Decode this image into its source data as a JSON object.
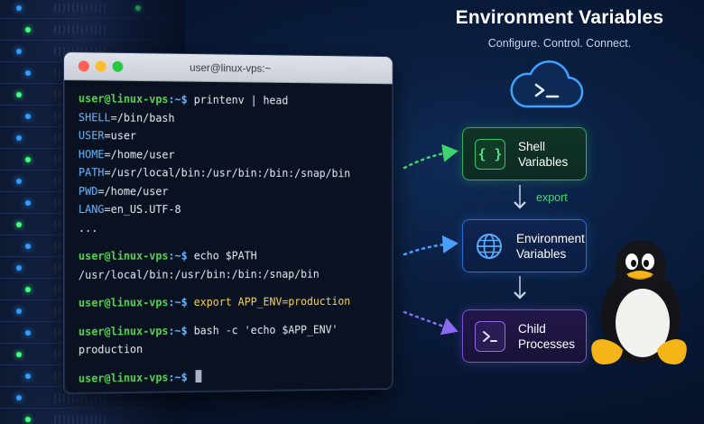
{
  "terminal": {
    "window_title": "user@linux-vps:~",
    "prompt_user": "user@linux-vps",
    "prompt_path": ":~$",
    "lines": [
      {
        "type": "prompt",
        "cmd": " printenv | head"
      },
      {
        "type": "var",
        "name": "SHELL",
        "value": "=/bin/bash"
      },
      {
        "type": "var",
        "name": "USER",
        "value": "=user"
      },
      {
        "type": "var",
        "name": "HOME",
        "value": "=/home/user"
      },
      {
        "type": "var",
        "name": "PATH",
        "value": "=/usr/local/bin:/usr/bin:/bin:/snap/bin"
      },
      {
        "type": "var",
        "name": "PWD",
        "value": "=/home/user"
      },
      {
        "type": "var",
        "name": "LANG",
        "value": "=en_US.UTF-8"
      },
      {
        "type": "out",
        "text": "..."
      },
      {
        "type": "gap"
      },
      {
        "type": "prompt",
        "cmd": " echo $PATH"
      },
      {
        "type": "out",
        "text": "/usr/local/bin:/usr/bin:/bin:/snap/bin"
      },
      {
        "type": "gap"
      },
      {
        "type": "prompt-export",
        "cmd": " export APP_ENV=production"
      },
      {
        "type": "gap"
      },
      {
        "type": "prompt",
        "cmd": " bash -c 'echo $APP_ENV'"
      },
      {
        "type": "out",
        "text": "production"
      },
      {
        "type": "gap"
      },
      {
        "type": "prompt-cursor",
        "cmd": " "
      }
    ]
  },
  "heading": {
    "title": "Environment Variables",
    "subtitle": "Configure. Control. Connect."
  },
  "cards": {
    "shell": {
      "line1": "Shell",
      "line2": "Variables",
      "icon": "braces-icon"
    },
    "env": {
      "line1": "Environment",
      "line2": "Variables",
      "icon": "globe-icon"
    },
    "child": {
      "line1": "Child",
      "line2": "Processes",
      "icon": "terminal-prompt-icon"
    }
  },
  "export_label": "export",
  "colors": {
    "prompt_user": "#58d34f",
    "prompt_path": "#6ab7ff",
    "export_cmd": "#f4d35e",
    "shell_card": "#2fae5c",
    "env_card": "#2a6fd6",
    "child_card": "#7b52d6"
  }
}
